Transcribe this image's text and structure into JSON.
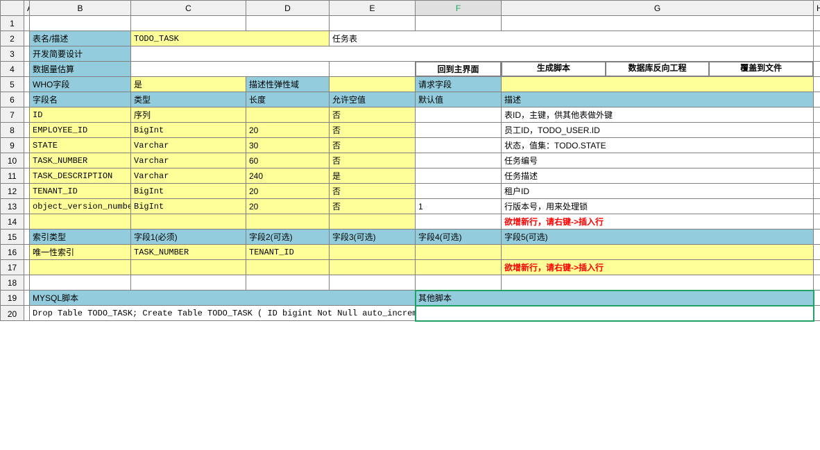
{
  "columns": [
    "A",
    "B",
    "C",
    "D",
    "E",
    "F",
    "G",
    "H"
  ],
  "rows": [
    "1",
    "2",
    "3",
    "4",
    "5",
    "6",
    "7",
    "8",
    "9",
    "10",
    "11",
    "12",
    "13",
    "14",
    "15",
    "16",
    "17",
    "18",
    "19",
    "20"
  ],
  "meta": {
    "r2b": "表名/描述",
    "r2c": "TODO_TASK",
    "r2e": "任务表",
    "r3b": "开发简要设计",
    "r4b": "数据量估算",
    "btn1": "回到主界面",
    "btn2": "生成脚本",
    "btn3": "数据库反向工程",
    "btn4": "覆盖到文件",
    "r5b": "WHO字段",
    "r5c": "是",
    "r5d": "描述性弹性域",
    "r5f": "请求字段"
  },
  "header": {
    "b": "字段名",
    "c": "类型",
    "d": "长度",
    "e": "允许空值",
    "f": "默认值",
    "g": "描述"
  },
  "fields": [
    {
      "b": "ID",
      "c": "序列",
      "d": "",
      "e": "否",
      "f": "",
      "g": "表ID，主键，供其他表做外键"
    },
    {
      "b": "EMPLOYEE_ID",
      "c": "BigInt",
      "d": "20",
      "e": "否",
      "f": "",
      "g": "员工ID，TODO_USER.ID"
    },
    {
      "b": "STATE",
      "c": "Varchar",
      "d": "30",
      "e": "否",
      "f": "",
      "g": "状态，值集：TODO.STATE"
    },
    {
      "b": "TASK_NUMBER",
      "c": "Varchar",
      "d": "60",
      "e": "否",
      "f": "",
      "g": "任务编号"
    },
    {
      "b": "TASK_DESCRIPTION",
      "c": "Varchar",
      "d": "240",
      "e": "是",
      "f": "",
      "g": "任务描述"
    },
    {
      "b": "TENANT_ID",
      "c": "BigInt",
      "d": "20",
      "e": "否",
      "f": "",
      "g": "租户ID"
    },
    {
      "b": "object_version_number",
      "c": "BigInt",
      "d": "20",
      "e": "否",
      "f": "1",
      "g": "行版本号，用来处理锁"
    }
  ],
  "hint_insert": "欲增新行，请右键->插入行",
  "index": {
    "hb": "索引类型",
    "hc": "字段1(必须)",
    "hd": "字段2(可选)",
    "he": "字段3(可选)",
    "hf": "字段4(可选)",
    "hg": "字段5(可选)",
    "r16b": "唯一性索引",
    "r16c": "TASK_NUMBER",
    "r16d": "TENANT_ID"
  },
  "script_hdr": {
    "b": "MYSQL脚本",
    "f": "其他脚本"
  },
  "script_body": "Drop Table TODO_TASK;\n\n\nCreate Table TODO_TASK\n(\n  ID bigint Not Null auto_increment primary key,\n  EMPLOYEE_ID BigInt(20) Not Null,\n  STATE Varchar(30) Not Null,\n  TASK_NUMBER Varchar(60) Not Null,\n  TASK_DESCRIPTION Varchar(240),"
}
